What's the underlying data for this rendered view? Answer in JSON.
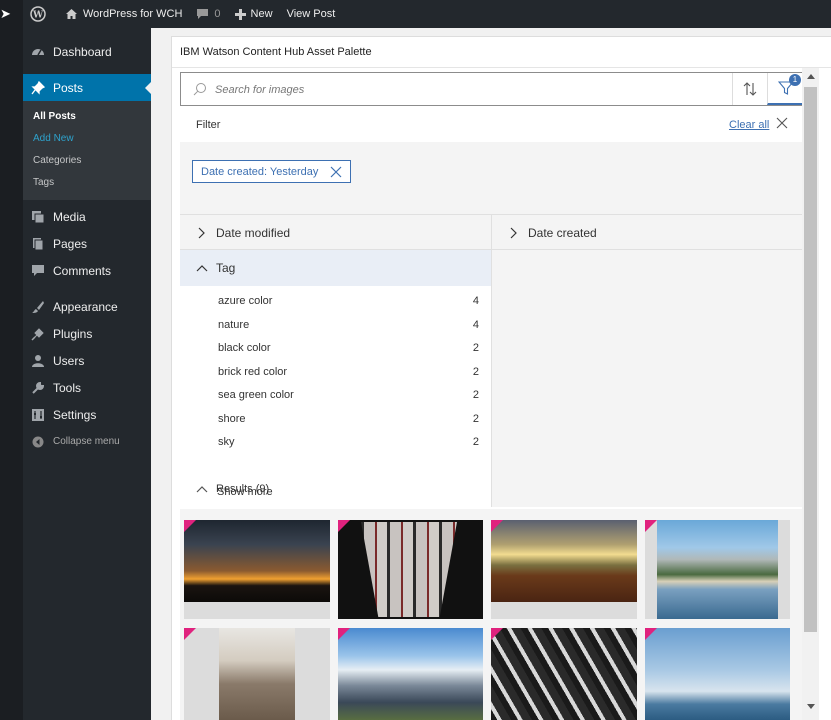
{
  "adminbar": {
    "site_name": "WordPress for WCH",
    "comments_count": "0",
    "new_label": "New",
    "view_post_label": "View Post"
  },
  "sidebar": {
    "items": [
      {
        "label": "Dashboard",
        "icon": "dashboard-icon"
      },
      {
        "label": "Posts",
        "icon": "pushpin-icon",
        "active": true
      },
      {
        "label": "Media",
        "icon": "media-icon"
      },
      {
        "label": "Pages",
        "icon": "pages-icon"
      },
      {
        "label": "Comments",
        "icon": "comment-icon"
      },
      {
        "label": "Appearance",
        "icon": "paintbrush-icon"
      },
      {
        "label": "Plugins",
        "icon": "plugin-icon"
      },
      {
        "label": "Users",
        "icon": "users-icon"
      },
      {
        "label": "Tools",
        "icon": "wrench-icon"
      },
      {
        "label": "Settings",
        "icon": "settings-icon"
      }
    ],
    "posts_submenu": [
      "All Posts",
      "Add New",
      "Categories",
      "Tags"
    ],
    "collapse_label": "Collapse menu"
  },
  "palette": {
    "title": "IBM Watson Content Hub Asset Palette",
    "search_placeholder": "Search for images",
    "filter_count": "1",
    "filter_label": "Filter",
    "clear_all": "Clear all",
    "chip_label": "Date created: Yesterday",
    "facets": {
      "date_modified": "Date modified",
      "date_created": "Date created",
      "tag": "Tag"
    },
    "tags": [
      {
        "name": "azure color",
        "count": "4"
      },
      {
        "name": "nature",
        "count": "4"
      },
      {
        "name": "black color",
        "count": "2"
      },
      {
        "name": "brick red color",
        "count": "2"
      },
      {
        "name": "sea green color",
        "count": "2"
      },
      {
        "name": "shore",
        "count": "2"
      },
      {
        "name": "sky",
        "count": "2"
      }
    ],
    "show_more": "Show more",
    "results_label": "Results (9)"
  },
  "colors": {
    "wp_dark": "#23282d",
    "wp_blue": "#0073aa",
    "ibm_blue": "#3d70b2",
    "tile_marker": "#e0227e"
  }
}
